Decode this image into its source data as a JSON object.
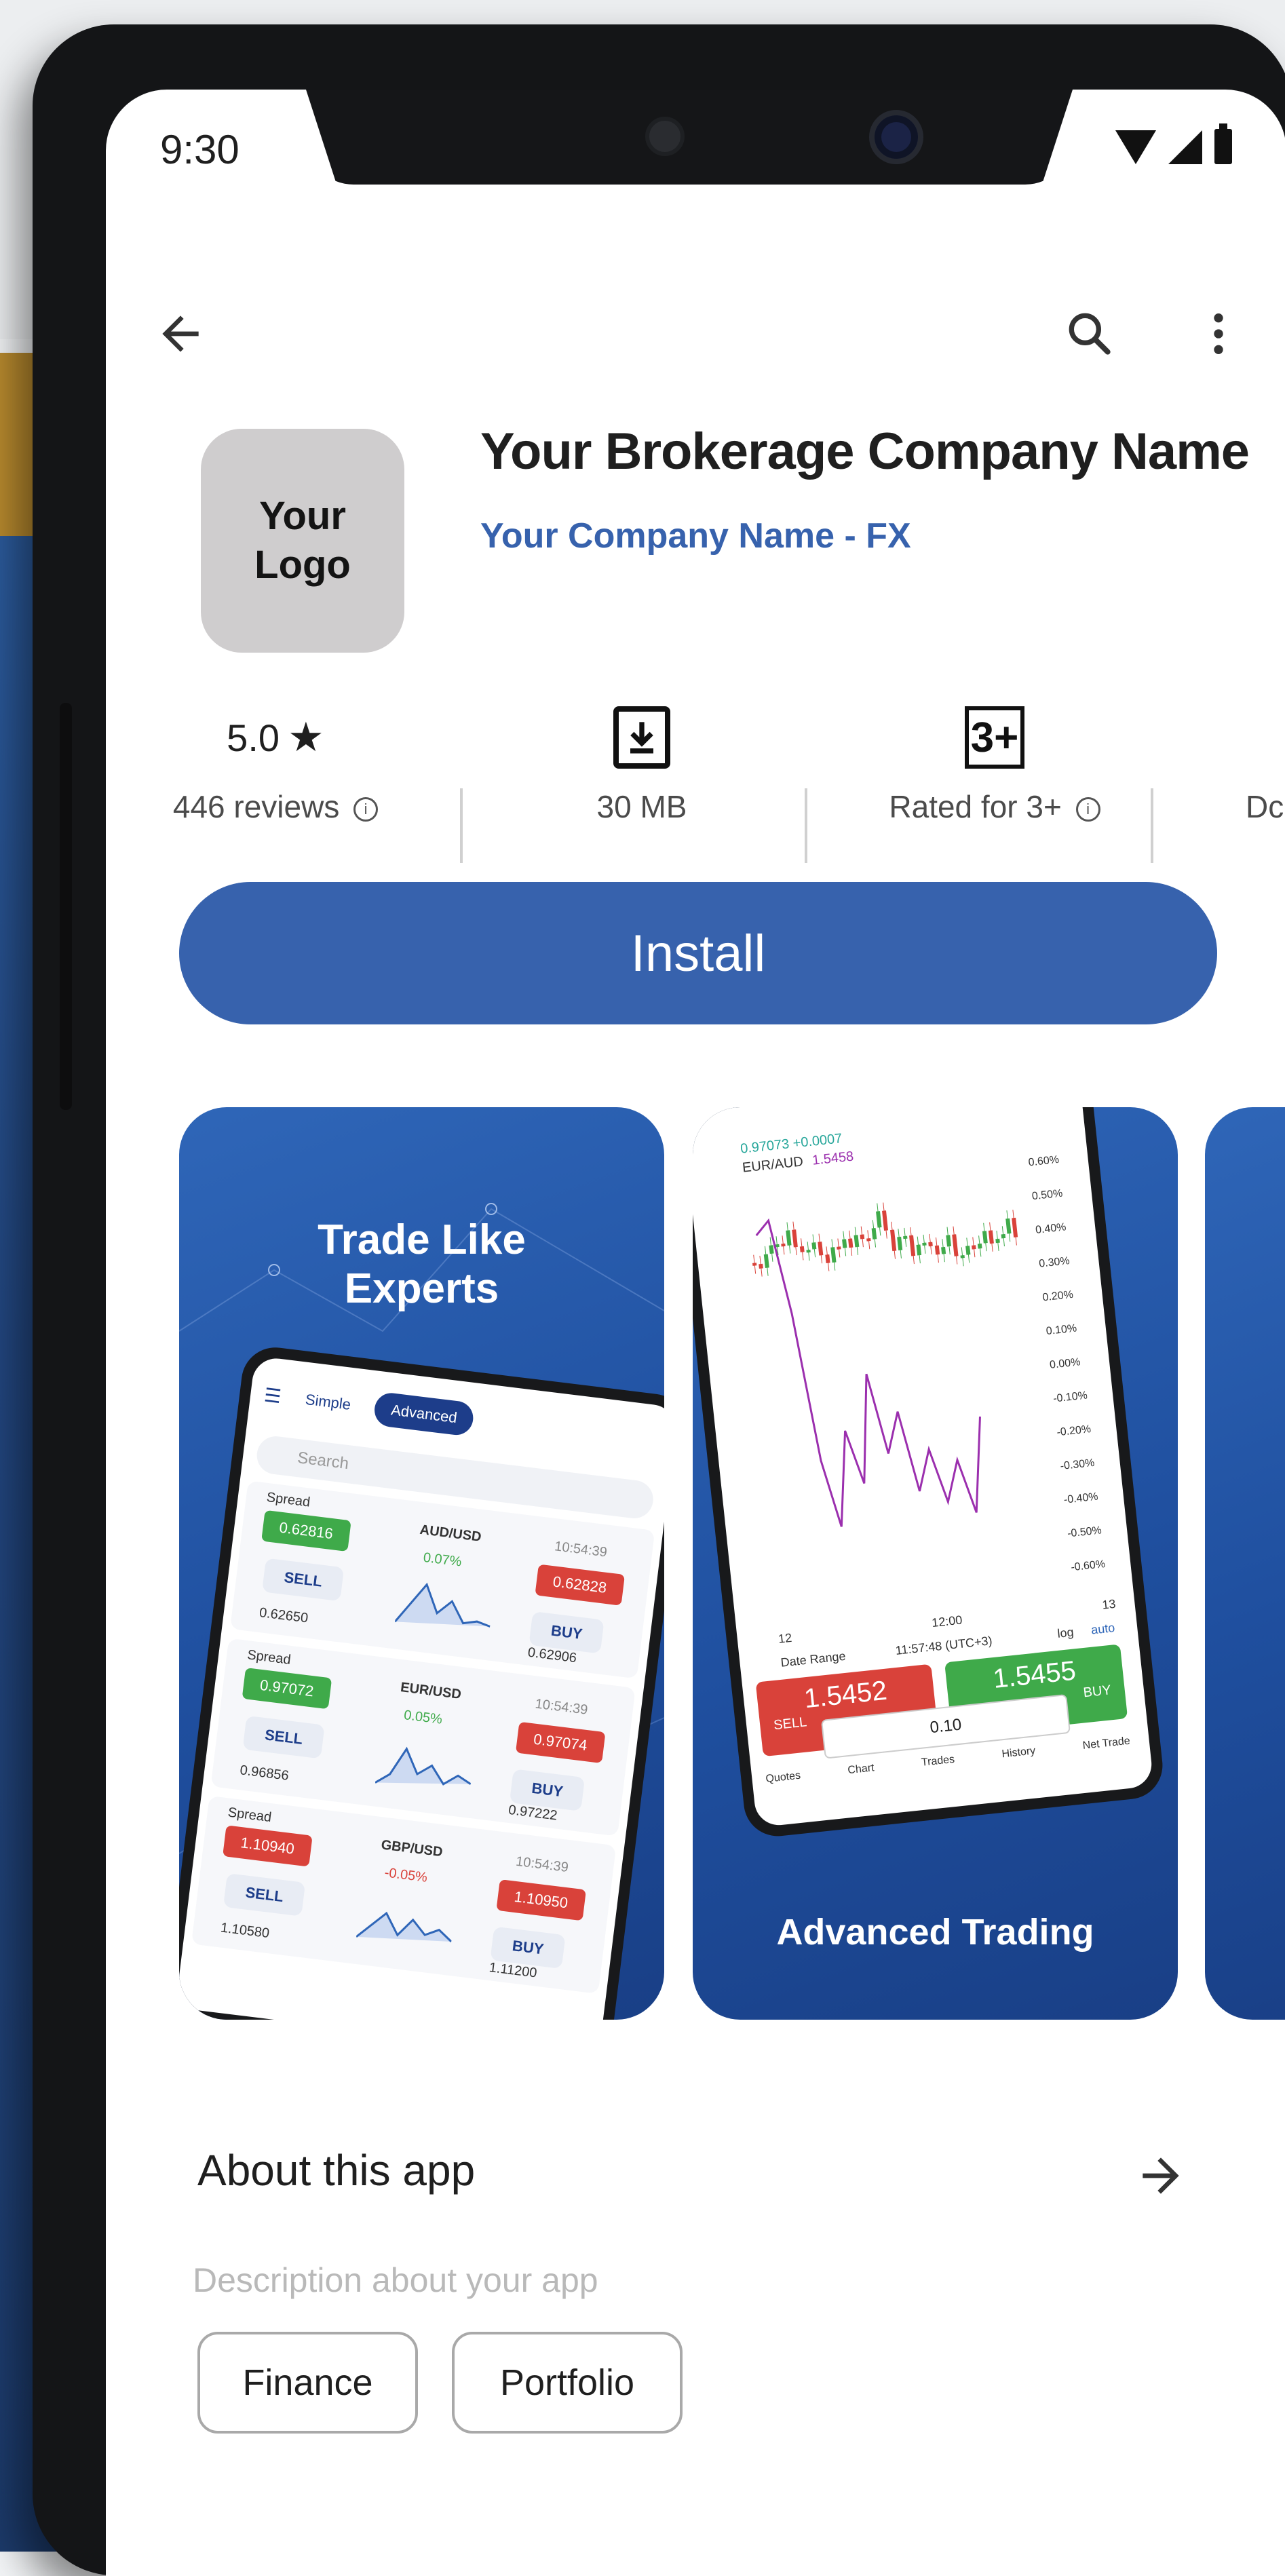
{
  "status_bar": {
    "time": "9:30"
  },
  "app": {
    "logo_text": "Your\nLogo",
    "title": "Your Brokerage Company Name",
    "developer": "Your Company Name - FX"
  },
  "stats": {
    "rating": "5.0",
    "reviews": "446 reviews",
    "size": "30 MB",
    "content_rating_badge": "3+",
    "content_rating": "Rated for 3+",
    "cut_off_label": "Dc"
  },
  "install_label": "Install",
  "screenshots": {
    "shot1": {
      "caption": "Trade Like\nExperts",
      "tabs": [
        "Simple",
        "Advanced"
      ],
      "search_placeholder": "Search",
      "spread_label": "Spread",
      "sell_label": "SELL",
      "buy_label": "BUY",
      "quotes": [
        {
          "pair": "AUD/USD",
          "spread": "0.62816",
          "change": "0.07%",
          "time": "10:54:39",
          "ask": "0.62828",
          "low": "0.62650",
          "high": "0.62906"
        },
        {
          "pair": "EUR/USD",
          "spread": "0.97072",
          "change": "0.05%",
          "time": "10:54:39",
          "ask": "0.97074",
          "low": "0.96856",
          "high": "0.97222"
        },
        {
          "pair": "GBP/USD",
          "spread": "1.10940",
          "change": "-0.05%",
          "time": "10:54:39",
          "ask": "1.10950",
          "low": "1.10580",
          "high": "1.11200"
        }
      ]
    },
    "shot2": {
      "caption": "Advanced Trading",
      "pair": "EUR/AUD",
      "pair_price": "1.5458",
      "top_quote": "0.97073 +0.0007",
      "sell_price": "1.5452",
      "buy_price": "1.5455",
      "sell_label": "SELL",
      "buy_label": "BUY",
      "lot": "0.10",
      "date_range": "Date Range",
      "timestamp": "11:57:48 (UTC+3)",
      "log_label": "log",
      "auto_label": "auto",
      "axis_labels": [
        "0.60%",
        "0.50%",
        "0.40%",
        "0.30%",
        "0.20%",
        "0.10%",
        "0.00%",
        "-0.10%",
        "-0.20%",
        "-0.30%",
        "-0.40%",
        "-0.50%",
        "-0.60%"
      ],
      "date_labels": [
        "12",
        "12:00",
        "13"
      ],
      "nav": [
        "Quotes",
        "Chart",
        "Trades",
        "History",
        "Net Trade"
      ]
    }
  },
  "about": {
    "title": "About this app",
    "description": "Description about your app"
  },
  "categories": [
    "Finance",
    "Portfolio"
  ],
  "colors": {
    "accent": "#3762ad",
    "buy": "#3faa4a",
    "sell": "#d9423a"
  }
}
